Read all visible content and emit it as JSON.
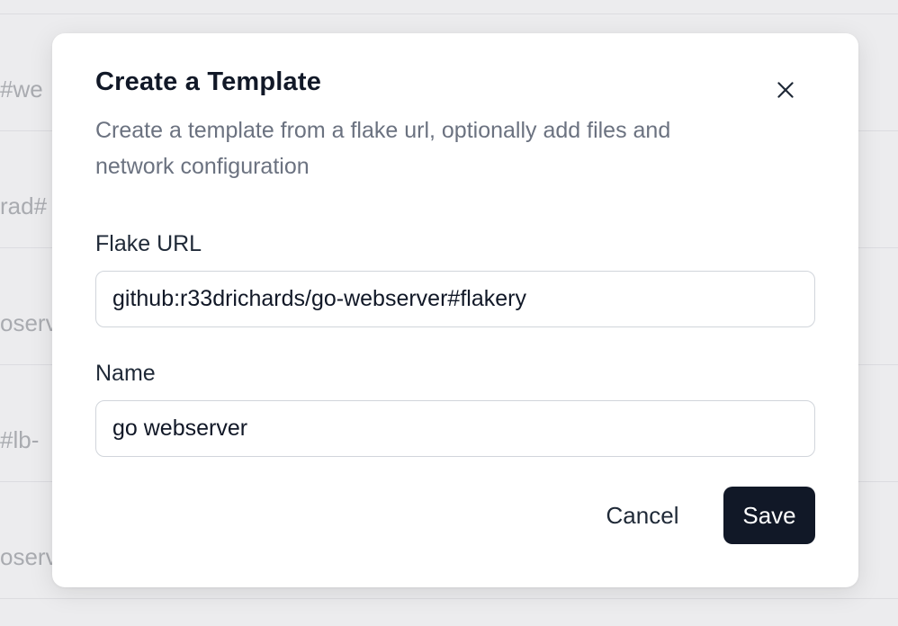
{
  "background": {
    "rows": [
      "#we",
      "rad#",
      "oserv",
      "#lb-",
      "oserv"
    ]
  },
  "dialog": {
    "title": "Create a Template",
    "description": "Create a template from a flake url, optionally add files and network configuration",
    "close_icon": "close-icon",
    "fields": {
      "flake_url": {
        "label": "Flake URL",
        "value": "github:r33drichards/go-webserver#flakery"
      },
      "name": {
        "label": "Name",
        "value": "go webserver"
      }
    },
    "actions": {
      "cancel_label": "Cancel",
      "save_label": "Save"
    }
  },
  "colors": {
    "primary_button": "#111827",
    "text_primary": "#111827",
    "text_muted": "#6b7280",
    "input_border": "#d1d5db"
  }
}
